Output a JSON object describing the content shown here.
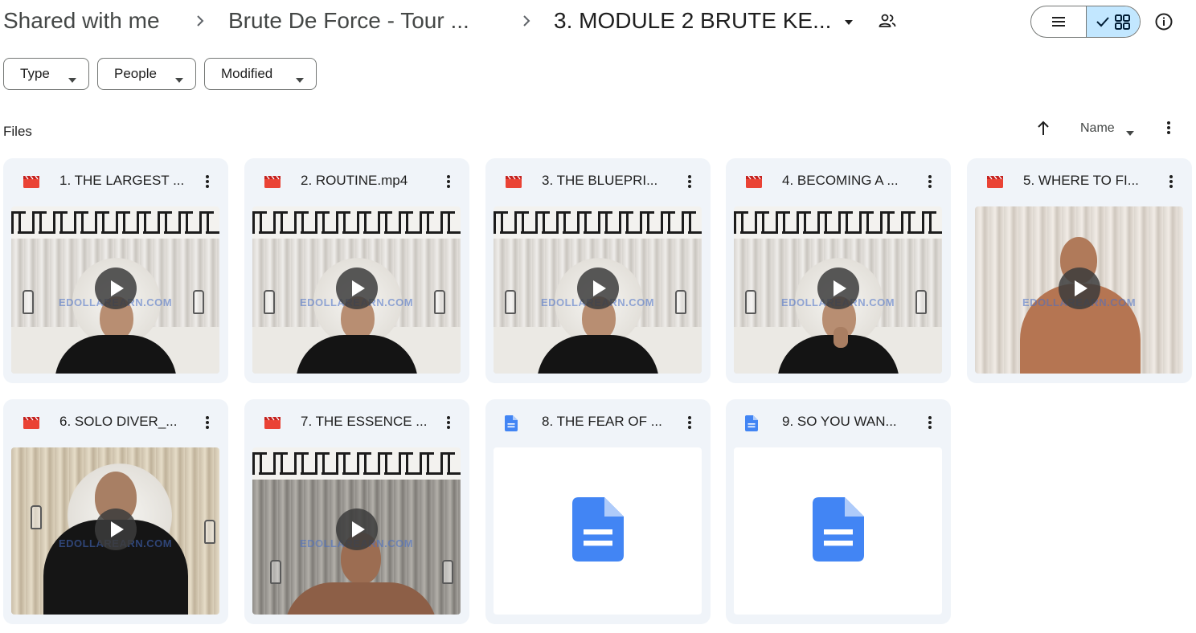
{
  "breadcrumb": {
    "root": "Shared with me",
    "parent": "Brute De Force - Tour ...",
    "current": "3. MODULE 2 BRUTE KE..."
  },
  "filters": [
    {
      "label": "Type"
    },
    {
      "label": "People"
    },
    {
      "label": "Modified"
    }
  ],
  "section": {
    "label": "Files"
  },
  "sort": {
    "label": "Name"
  },
  "files": [
    {
      "title": "1. THE LARGEST ...",
      "kind": "video",
      "icon": "video-file-icon",
      "watermark": "EDOLLAREARN.COM"
    },
    {
      "title": "2. ROUTINE.mp4",
      "kind": "video",
      "icon": "video-file-icon",
      "watermark": "EDOLLAREARN.COM"
    },
    {
      "title": "3. THE BLUEPRI...",
      "kind": "video",
      "icon": "video-file-icon",
      "watermark": "EDOLLAREARN.COM"
    },
    {
      "title": "4. BECOMING A ...",
      "kind": "video",
      "icon": "video-file-icon",
      "watermark": "EDOLLAREARN.COM"
    },
    {
      "title": "5. WHERE TO FI...",
      "kind": "video",
      "icon": "video-file-icon",
      "watermark": "EDOLLAREARN.COM"
    },
    {
      "title": "6. SOLO DIVER_...",
      "kind": "video",
      "icon": "video-file-icon",
      "watermark": "EDOLLAREARN.COM"
    },
    {
      "title": "7. THE ESSENCE ...",
      "kind": "video",
      "icon": "video-file-icon",
      "watermark": "EDOLLAREARN.COM"
    },
    {
      "title": "8. THE FEAR OF ...",
      "kind": "doc",
      "icon": "google-doc-icon"
    },
    {
      "title": "9. SO YOU WAN...",
      "kind": "doc",
      "icon": "google-doc-icon"
    }
  ],
  "colors": {
    "accent": "#c2e7ff",
    "card_bg": "#f0f4f9",
    "video_red": "#ea4335",
    "doc_blue": "#4285f4"
  }
}
